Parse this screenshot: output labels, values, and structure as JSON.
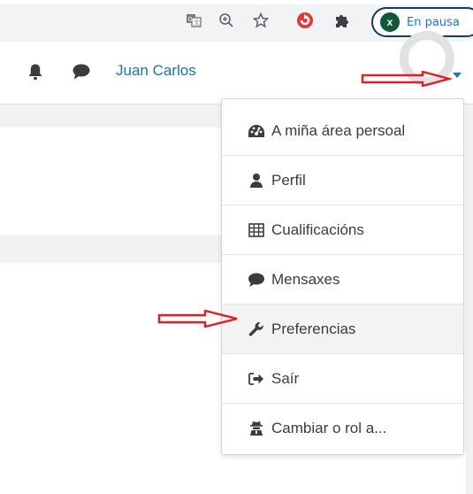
{
  "browser": {
    "profile_initial": "x",
    "profile_status": "En pausa"
  },
  "navbar": {
    "user_name": "Juan Carlos"
  },
  "user_menu": {
    "items": [
      {
        "label": "A miña área persoal",
        "icon": "dashboard-icon"
      },
      {
        "label": "Perfil",
        "icon": "user-icon"
      },
      {
        "label": "Cualificacións",
        "icon": "table-icon"
      },
      {
        "label": "Mensaxes",
        "icon": "chat-icon"
      },
      {
        "label": "Preferencias",
        "icon": "wrench-icon"
      },
      {
        "label": "Saír",
        "icon": "sign-out-icon"
      },
      {
        "label": "Cambiar o rol a...",
        "icon": "user-secret-icon"
      }
    ]
  },
  "colors": {
    "link_blue": "#1a73ae",
    "annotation_red": "#e02020",
    "profile_green": "#10583a"
  }
}
